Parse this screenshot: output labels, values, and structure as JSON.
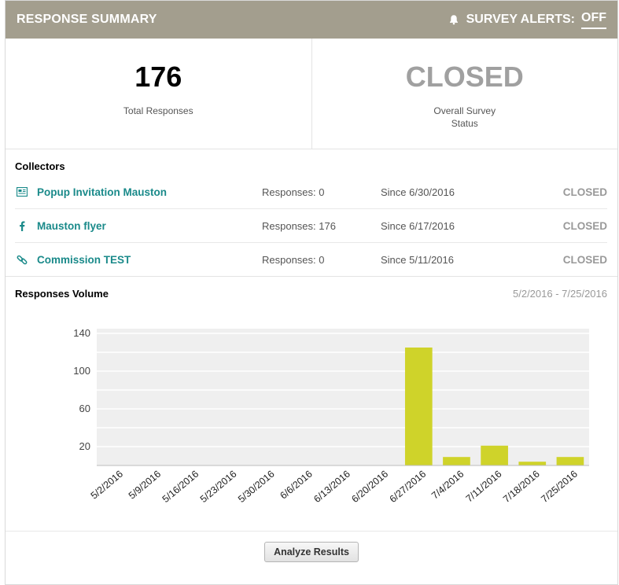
{
  "header": {
    "title": "RESPONSE SUMMARY",
    "alerts_label": "SURVEY ALERTS:",
    "alerts_value": "OFF",
    "alerts_icon": "bell-icon"
  },
  "stats": {
    "total": {
      "value": "176",
      "label": "Total Responses"
    },
    "status": {
      "value": "CLOSED",
      "label": "Overall Survey Status"
    }
  },
  "collectors": {
    "title": "Collectors",
    "items": [
      {
        "icon": "web-form-icon",
        "name": "Popup Invitation Mauston",
        "responses": "Responses: 0",
        "since": "Since 6/30/2016",
        "status": "CLOSED"
      },
      {
        "icon": "facebook-icon",
        "name": "Mauston flyer",
        "responses": "Responses: 176",
        "since": "Since 6/17/2016",
        "status": "CLOSED"
      },
      {
        "icon": "link-icon",
        "name": "Commission TEST",
        "responses": "Responses: 0",
        "since": "Since 5/11/2016",
        "status": "CLOSED"
      }
    ]
  },
  "volume": {
    "title": "Responses Volume",
    "range": "5/2/2016 - 7/25/2016"
  },
  "chart_data": {
    "type": "bar",
    "categories": [
      "5/2/2016",
      "5/9/2016",
      "5/16/2016",
      "5/23/2016",
      "5/30/2016",
      "6/6/2016",
      "6/13/2016",
      "6/20/2016",
      "6/27/2016",
      "7/4/2016",
      "7/11/2016",
      "7/18/2016",
      "7/25/2016"
    ],
    "values": [
      0,
      0,
      0,
      0,
      0,
      0,
      0,
      0,
      125,
      9,
      21,
      4,
      9
    ],
    "ylim": [
      0,
      145
    ],
    "yticks": [
      20,
      60,
      100,
      140
    ],
    "grid": true,
    "bar_color": "#cfd32a"
  },
  "footer": {
    "button_label": "Analyze Results"
  }
}
